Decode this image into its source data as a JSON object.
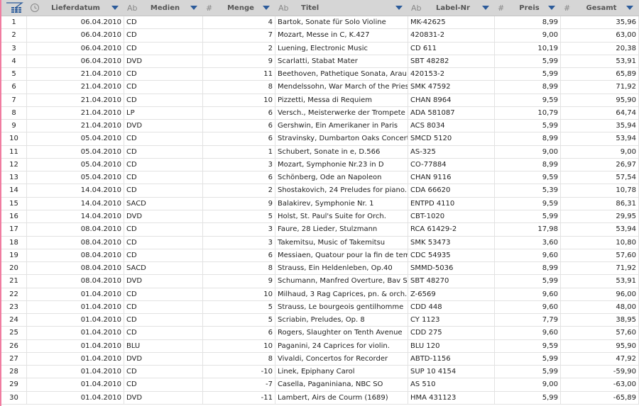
{
  "header": {
    "columns": [
      {
        "type": "",
        "label": "Lieferdatum"
      },
      {
        "type": "Ab",
        "label": "Medien"
      },
      {
        "type": "#",
        "label": "Menge"
      },
      {
        "type": "Ab",
        "label": "Titel"
      },
      {
        "type": "Ab",
        "label": "Label-Nr"
      },
      {
        "type": "#",
        "label": "Preis"
      },
      {
        "type": "#",
        "label": "Gesamt"
      }
    ]
  },
  "rows": [
    [
      "1",
      "06.04.2010",
      "CD",
      "4",
      "Bartok, Sonate für Solo Violine",
      "MK-42625",
      "8,99",
      "35,96"
    ],
    [
      "2",
      "06.04.2010",
      "CD",
      "7",
      "Mozart, Messe in C, K.427",
      "420831-2",
      "9,00",
      "63,00"
    ],
    [
      "3",
      "06.04.2010",
      "CD",
      "2",
      "Luening, Electronic Music",
      "CD 611",
      "10,19",
      "20,38"
    ],
    [
      "4",
      "06.04.2010",
      "DVD",
      "9",
      "Scarlatti, Stabat Mater",
      "SBT 48282",
      "5,99",
      "53,91"
    ],
    [
      "5",
      "21.04.2010",
      "CD",
      "11",
      "Beethoven, Pathetique Sonata, Arau",
      "420153-2",
      "5,99",
      "65,89"
    ],
    [
      "6",
      "21.04.2010",
      "CD",
      "8",
      "Mendelssohn, War March of the Priests",
      "SMK 47592",
      "8,99",
      "71,92"
    ],
    [
      "7",
      "21.04.2010",
      "CD",
      "10",
      "Pizzetti, Messa di Requiem",
      "CHAN 8964",
      "9,59",
      "95,90"
    ],
    [
      "8",
      "21.04.2010",
      "LP",
      "6",
      "Versch., Meisterwerke der Trompete",
      "ADA 581087",
      "10,79",
      "64,74"
    ],
    [
      "9",
      "21.04.2010",
      "DVD",
      "6",
      "Gershwin, Ein Amerikaner in Paris",
      "ACS 8034",
      "5,99",
      "35,94"
    ],
    [
      "10",
      "05.04.2010",
      "CD",
      "6",
      "Stravinsky, Dumbarton Oaks Concerto",
      "SMCD 5120",
      "8,99",
      "53,94"
    ],
    [
      "11",
      "05.04.2010",
      "CD",
      "1",
      "Schubert, Sonate in e, D.566",
      "AS-325",
      "9,00",
      "9,00"
    ],
    [
      "12",
      "05.04.2010",
      "CD",
      "3",
      "Mozart, Symphonie Nr.23 in D",
      "CO-77884",
      "8,99",
      "26,97"
    ],
    [
      "13",
      "05.04.2010",
      "CD",
      "6",
      "Schönberg, Ode an Napoleon",
      "CHAN 9116",
      "9,59",
      "57,54"
    ],
    [
      "14",
      "14.04.2010",
      "CD",
      "2",
      "Shostakovich, 24 Preludes for piano.",
      "CDA 66620",
      "5,39",
      "10,78"
    ],
    [
      "15",
      "14.04.2010",
      "SACD",
      "9",
      "Balakirev, Symphonie Nr. 1",
      "ENTPD 4110",
      "9,59",
      "86,31"
    ],
    [
      "16",
      "14.04.2010",
      "DVD",
      "5",
      "Holst, St. Paul's Suite for Orch.",
      "CBT-1020",
      "5,99",
      "29,95"
    ],
    [
      "17",
      "08.04.2010",
      "CD",
      "3",
      "Faure, 28 Lieder, Stulzmann",
      "RCA 61429-2",
      "17,98",
      "53,94"
    ],
    [
      "18",
      "08.04.2010",
      "CD",
      "3",
      "Takemitsu, Music of Takemitsu",
      "SMK 53473",
      "3,60",
      "10,80"
    ],
    [
      "19",
      "08.04.2010",
      "CD",
      "6",
      "Messiaen, Quatour pour la fin de temps",
      "CDC 54935",
      "9,60",
      "57,60"
    ],
    [
      "20",
      "08.04.2010",
      "SACD",
      "8",
      "Strauss, Ein Heldenleben, Op.40",
      "SMMD-5036",
      "8,99",
      "71,92"
    ],
    [
      "21",
      "08.04.2010",
      "DVD",
      "9",
      "Schumann, Manfred Overture, Bav SO",
      "SBT 48270",
      "5,99",
      "53,91"
    ],
    [
      "22",
      "01.04.2010",
      "CD",
      "10",
      "Milhaud, 3 Rag Caprices, pn. & orch.",
      "Z-6569",
      "9,60",
      "96,00"
    ],
    [
      "23",
      "01.04.2010",
      "CD",
      "5",
      "Strauss, Le bourgeois gentilhomme",
      "CDD 448",
      "9,60",
      "48,00"
    ],
    [
      "24",
      "01.04.2010",
      "CD",
      "5",
      "Scriabin, Preludes, Op. 8",
      "CY 1123",
      "7,79",
      "38,95"
    ],
    [
      "25",
      "01.04.2010",
      "CD",
      "6",
      "Rogers, Slaughter on Tenth Avenue",
      "CDD 275",
      "9,60",
      "57,60"
    ],
    [
      "26",
      "01.04.2010",
      "BLU",
      "10",
      "Paganini, 24 Caprices for violin.",
      "BLU 120",
      "9,59",
      "95,90"
    ],
    [
      "27",
      "01.04.2010",
      "DVD",
      "8",
      "Vivaldi, Concertos for Recorder",
      "ABTD-1156",
      "5,99",
      "47,92"
    ],
    [
      "28",
      "01.04.2010",
      "CD",
      "-10",
      "Linek, Epiphany Carol",
      "SUP 10 4154",
      "5,99",
      "-59,90"
    ],
    [
      "29",
      "01.04.2010",
      "CD",
      "-7",
      "Casella, Paganiniana, NBC SO",
      "AS 510",
      "9,00",
      "-63,00"
    ],
    [
      "30",
      "01.04.2010",
      "DVD",
      "-11",
      "Lambert, Airs de Courm (1689)",
      "HMA 431123",
      "5,99",
      "-65,89"
    ]
  ]
}
